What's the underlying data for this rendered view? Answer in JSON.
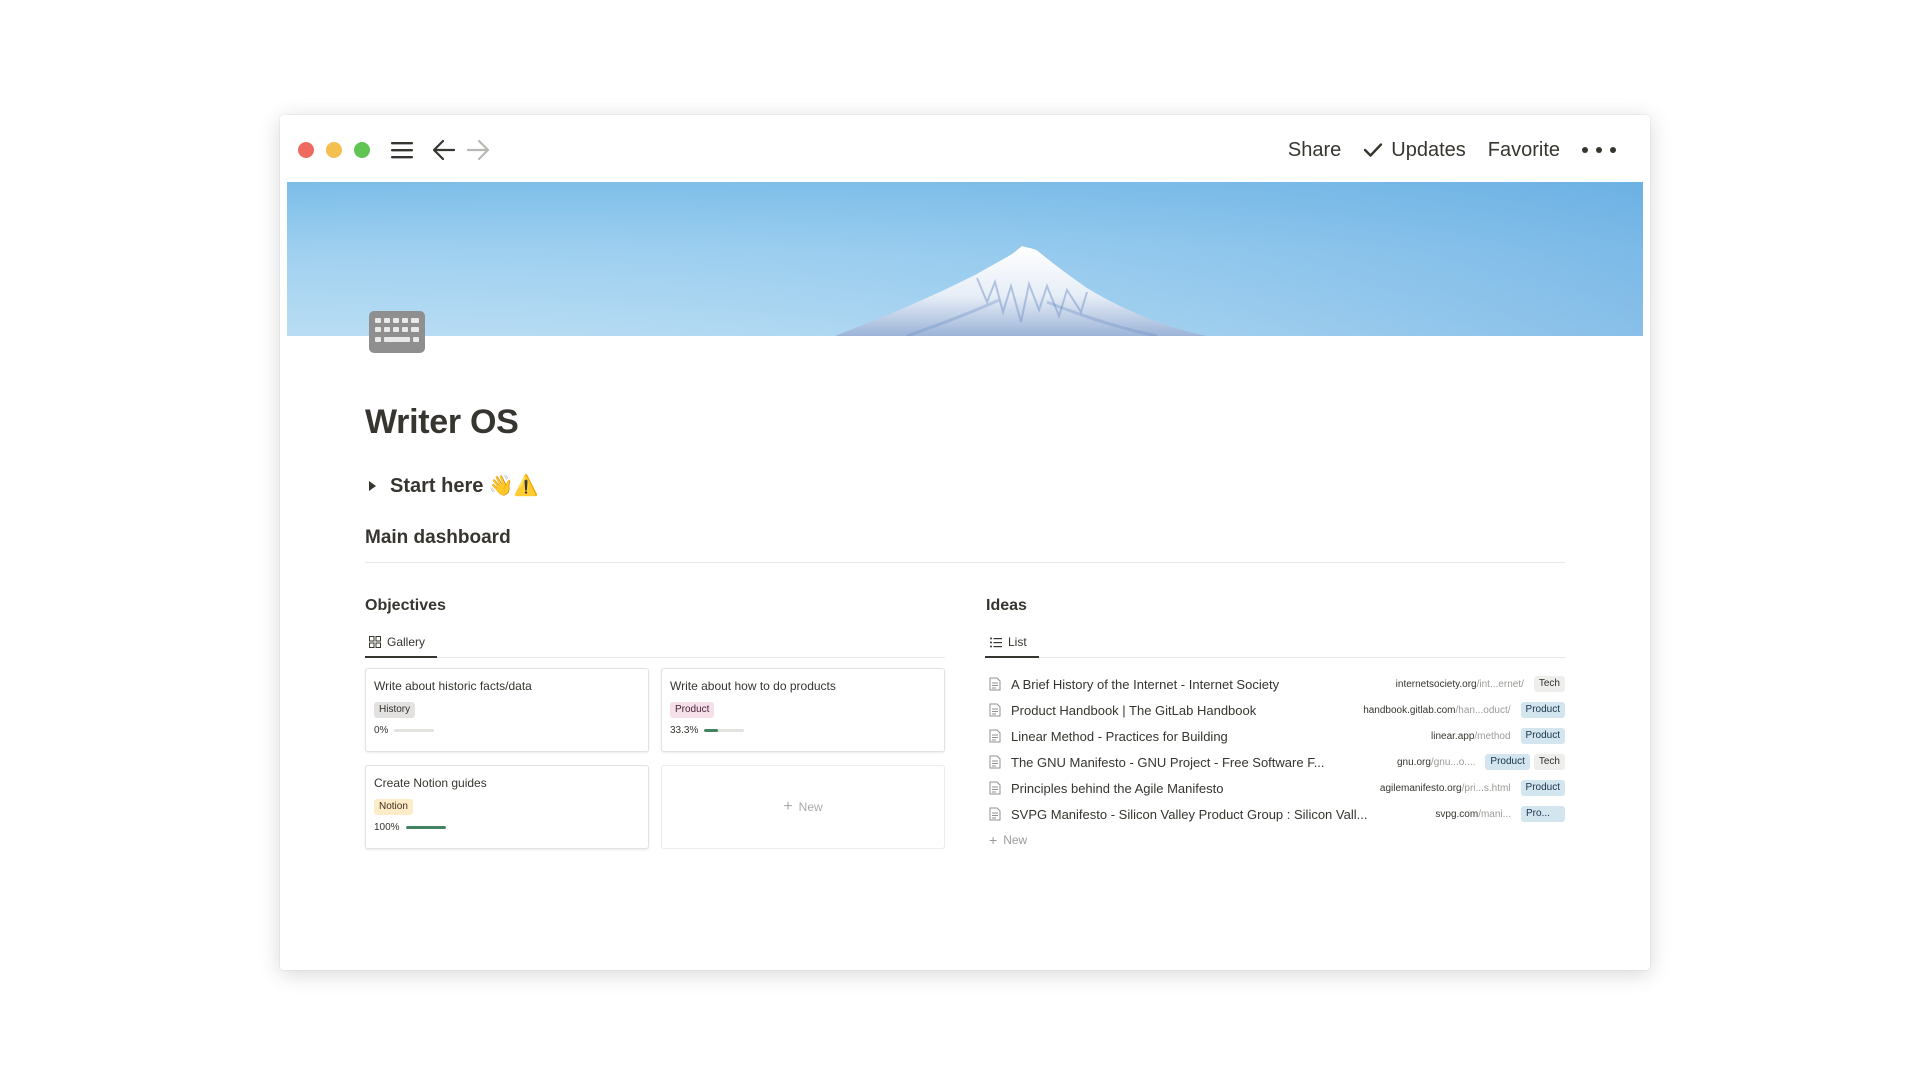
{
  "colors": {
    "traffic_red": "#ee6a5e",
    "traffic_yellow": "#f5bf4f",
    "traffic_green": "#61c554",
    "text": "#37352f",
    "progress": "#448361",
    "cover_sky": "#7bbde8"
  },
  "toolbar": {
    "share_label": "Share",
    "updates_label": "Updates",
    "favorite_label": "Favorite",
    "menu_icon": "hamburger-icon",
    "back_icon": "arrow-left-icon",
    "forward_icon": "arrow-right-icon",
    "more_icon": "more-dots-icon"
  },
  "page": {
    "icon": "keyboard-icon",
    "title": "Writer OS",
    "toggle_label": "Start here 👋⚠️",
    "section_heading": "Main dashboard"
  },
  "objectives": {
    "title": "Objectives",
    "view_label": "Gallery",
    "cards": [
      {
        "title": "Write about historic facts/data",
        "tag": "History",
        "progress_label": "0%",
        "progress": 0
      },
      {
        "title": "Write about how to do products",
        "tag": "Product",
        "progress_label": "33.3%",
        "progress": 0.333
      },
      {
        "title": "Create Notion guides",
        "tag": "Notion",
        "progress_label": "100%",
        "progress": 1.0
      }
    ],
    "new_label": "New"
  },
  "ideas": {
    "title": "Ideas",
    "view_label": "List",
    "items": [
      {
        "title": "A Brief History of the Internet - Internet Society",
        "url_main": "internetsociety.org",
        "url_rest": "/int...ernet/",
        "tags": [
          "Tech"
        ]
      },
      {
        "title": "Product Handbook | The GitLab Handbook",
        "url_main": "handbook.gitlab.com",
        "url_rest": "/han...oduct/",
        "tags": [
          "Product"
        ]
      },
      {
        "title": "Linear Method - Practices for Building",
        "url_main": "linear.app",
        "url_rest": "/method",
        "tags": [
          "Product"
        ]
      },
      {
        "title": "The GNU Manifesto - GNU Project - Free Software F...",
        "url_main": "gnu.org",
        "url_rest": "/gnu...o....",
        "tags": [
          "Product",
          "Tech"
        ]
      },
      {
        "title": "Principles behind the Agile Manifesto",
        "url_main": "agilemanifesto.org",
        "url_rest": "/pri...s.html",
        "tags": [
          "Product"
        ]
      },
      {
        "title": "SVPG Manifesto - Silicon Valley Product Group : Silicon Vall...",
        "url_main": "svpg.com",
        "url_rest": "/mani...",
        "tags": [
          "Pro..."
        ]
      }
    ],
    "new_label": "New"
  }
}
